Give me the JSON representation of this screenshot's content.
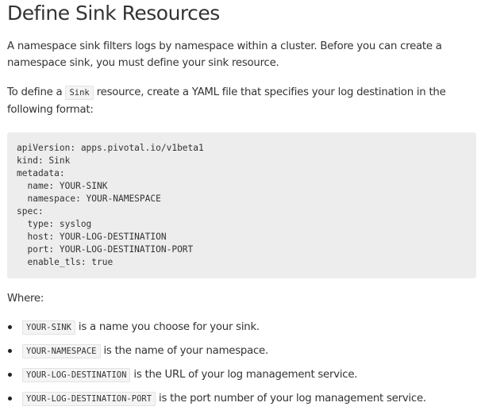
{
  "title": "Define Sink Resources",
  "intro": "A namespace sink filters logs by namespace within a cluster. Before you can create a namespace sink, you must define your sink resource.",
  "define_para": {
    "before": "To define a ",
    "code": "Sink",
    "after": " resource, create a YAML file that specifies your log destination in the following format:"
  },
  "code_block": "apiVersion: apps.pivotal.io/v1beta1\nkind: Sink\nmetadata:\n  name: YOUR-SINK\n  namespace: YOUR-NAMESPACE\nspec:\n  type: syslog\n  host: YOUR-LOG-DESTINATION\n  port: YOUR-LOG-DESTINATION-PORT\n  enable_tls: true",
  "where_label": "Where:",
  "where_items": [
    {
      "code": "YOUR-SINK",
      "text": " is a name you choose for your sink."
    },
    {
      "code": "YOUR-NAMESPACE",
      "text": " is the name of your namespace."
    },
    {
      "code": "YOUR-LOG-DESTINATION",
      "text": " is the URL of your log management service."
    },
    {
      "code": "YOUR-LOG-DESTINATION-PORT",
      "text": " is the port number of your log management service."
    }
  ]
}
